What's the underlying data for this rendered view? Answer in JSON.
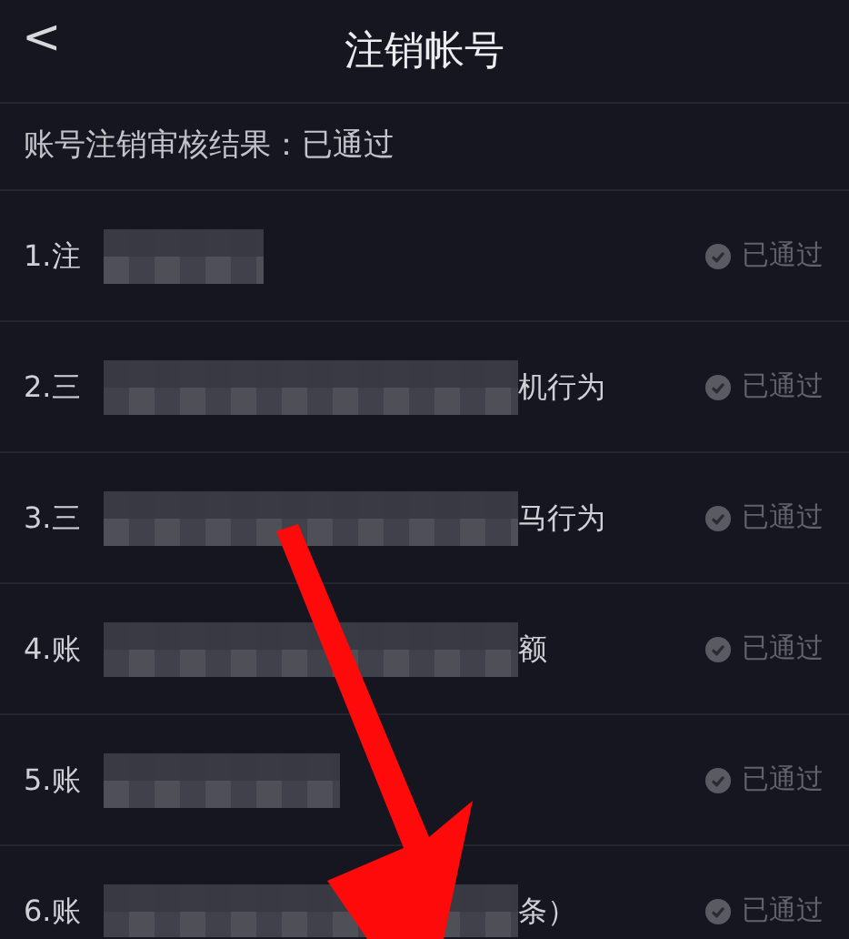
{
  "header": {
    "back": "<",
    "title": "注销帐号"
  },
  "result": "账号注销审核结果：已通过",
  "items": [
    {
      "prefix": "1.注",
      "status": "已通过"
    },
    {
      "prefix": "2.三",
      "suffix": "机行为",
      "status": "已通过"
    },
    {
      "prefix": "3.三",
      "suffix": "马行为",
      "status": "已通过"
    },
    {
      "prefix": "4.账",
      "suffix": "额",
      "status": "已通过"
    },
    {
      "prefix": "5.账",
      "status": "已通过"
    },
    {
      "prefix": "6.账",
      "suffix": "条）",
      "status": "已通过"
    }
  ]
}
